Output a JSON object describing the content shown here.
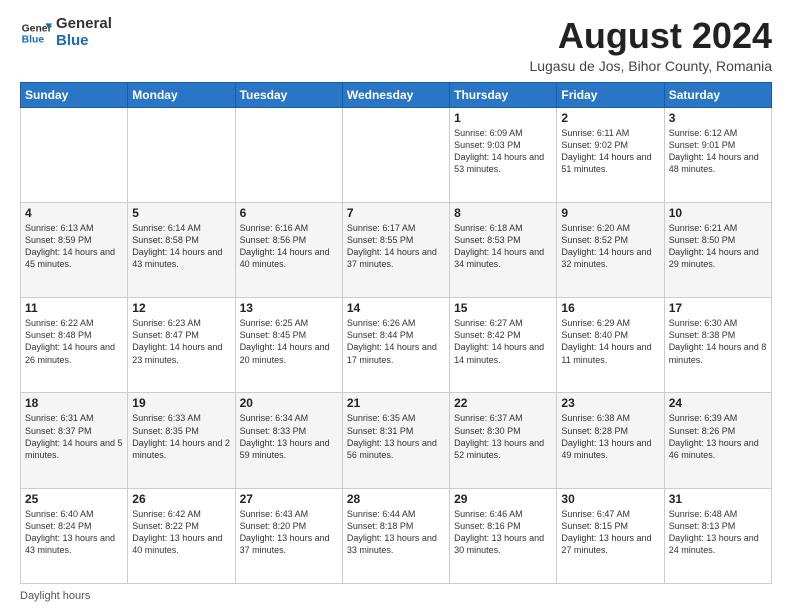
{
  "header": {
    "logo_general": "General",
    "logo_blue": "Blue",
    "main_title": "August 2024",
    "subtitle": "Lugasu de Jos, Bihor County, Romania"
  },
  "days_of_week": [
    "Sunday",
    "Monday",
    "Tuesday",
    "Wednesday",
    "Thursday",
    "Friday",
    "Saturday"
  ],
  "weeks": [
    [
      {
        "day": "",
        "info": ""
      },
      {
        "day": "",
        "info": ""
      },
      {
        "day": "",
        "info": ""
      },
      {
        "day": "",
        "info": ""
      },
      {
        "day": "1",
        "info": "Sunrise: 6:09 AM\nSunset: 9:03 PM\nDaylight: 14 hours\nand 53 minutes."
      },
      {
        "day": "2",
        "info": "Sunrise: 6:11 AM\nSunset: 9:02 PM\nDaylight: 14 hours\nand 51 minutes."
      },
      {
        "day": "3",
        "info": "Sunrise: 6:12 AM\nSunset: 9:01 PM\nDaylight: 14 hours\nand 48 minutes."
      }
    ],
    [
      {
        "day": "4",
        "info": "Sunrise: 6:13 AM\nSunset: 8:59 PM\nDaylight: 14 hours\nand 45 minutes."
      },
      {
        "day": "5",
        "info": "Sunrise: 6:14 AM\nSunset: 8:58 PM\nDaylight: 14 hours\nand 43 minutes."
      },
      {
        "day": "6",
        "info": "Sunrise: 6:16 AM\nSunset: 8:56 PM\nDaylight: 14 hours\nand 40 minutes."
      },
      {
        "day": "7",
        "info": "Sunrise: 6:17 AM\nSunset: 8:55 PM\nDaylight: 14 hours\nand 37 minutes."
      },
      {
        "day": "8",
        "info": "Sunrise: 6:18 AM\nSunset: 8:53 PM\nDaylight: 14 hours\nand 34 minutes."
      },
      {
        "day": "9",
        "info": "Sunrise: 6:20 AM\nSunset: 8:52 PM\nDaylight: 14 hours\nand 32 minutes."
      },
      {
        "day": "10",
        "info": "Sunrise: 6:21 AM\nSunset: 8:50 PM\nDaylight: 14 hours\nand 29 minutes."
      }
    ],
    [
      {
        "day": "11",
        "info": "Sunrise: 6:22 AM\nSunset: 8:48 PM\nDaylight: 14 hours\nand 26 minutes."
      },
      {
        "day": "12",
        "info": "Sunrise: 6:23 AM\nSunset: 8:47 PM\nDaylight: 14 hours\nand 23 minutes."
      },
      {
        "day": "13",
        "info": "Sunrise: 6:25 AM\nSunset: 8:45 PM\nDaylight: 14 hours\nand 20 minutes."
      },
      {
        "day": "14",
        "info": "Sunrise: 6:26 AM\nSunset: 8:44 PM\nDaylight: 14 hours\nand 17 minutes."
      },
      {
        "day": "15",
        "info": "Sunrise: 6:27 AM\nSunset: 8:42 PM\nDaylight: 14 hours\nand 14 minutes."
      },
      {
        "day": "16",
        "info": "Sunrise: 6:29 AM\nSunset: 8:40 PM\nDaylight: 14 hours\nand 11 minutes."
      },
      {
        "day": "17",
        "info": "Sunrise: 6:30 AM\nSunset: 8:38 PM\nDaylight: 14 hours\nand 8 minutes."
      }
    ],
    [
      {
        "day": "18",
        "info": "Sunrise: 6:31 AM\nSunset: 8:37 PM\nDaylight: 14 hours\nand 5 minutes."
      },
      {
        "day": "19",
        "info": "Sunrise: 6:33 AM\nSunset: 8:35 PM\nDaylight: 14 hours\nand 2 minutes."
      },
      {
        "day": "20",
        "info": "Sunrise: 6:34 AM\nSunset: 8:33 PM\nDaylight: 13 hours\nand 59 minutes."
      },
      {
        "day": "21",
        "info": "Sunrise: 6:35 AM\nSunset: 8:31 PM\nDaylight: 13 hours\nand 56 minutes."
      },
      {
        "day": "22",
        "info": "Sunrise: 6:37 AM\nSunset: 8:30 PM\nDaylight: 13 hours\nand 52 minutes."
      },
      {
        "day": "23",
        "info": "Sunrise: 6:38 AM\nSunset: 8:28 PM\nDaylight: 13 hours\nand 49 minutes."
      },
      {
        "day": "24",
        "info": "Sunrise: 6:39 AM\nSunset: 8:26 PM\nDaylight: 13 hours\nand 46 minutes."
      }
    ],
    [
      {
        "day": "25",
        "info": "Sunrise: 6:40 AM\nSunset: 8:24 PM\nDaylight: 13 hours\nand 43 minutes."
      },
      {
        "day": "26",
        "info": "Sunrise: 6:42 AM\nSunset: 8:22 PM\nDaylight: 13 hours\nand 40 minutes."
      },
      {
        "day": "27",
        "info": "Sunrise: 6:43 AM\nSunset: 8:20 PM\nDaylight: 13 hours\nand 37 minutes."
      },
      {
        "day": "28",
        "info": "Sunrise: 6:44 AM\nSunset: 8:18 PM\nDaylight: 13 hours\nand 33 minutes."
      },
      {
        "day": "29",
        "info": "Sunrise: 6:46 AM\nSunset: 8:16 PM\nDaylight: 13 hours\nand 30 minutes."
      },
      {
        "day": "30",
        "info": "Sunrise: 6:47 AM\nSunset: 8:15 PM\nDaylight: 13 hours\nand 27 minutes."
      },
      {
        "day": "31",
        "info": "Sunrise: 6:48 AM\nSunset: 8:13 PM\nDaylight: 13 hours\nand 24 minutes."
      }
    ]
  ],
  "footer": {
    "daylight_label": "Daylight hours"
  }
}
